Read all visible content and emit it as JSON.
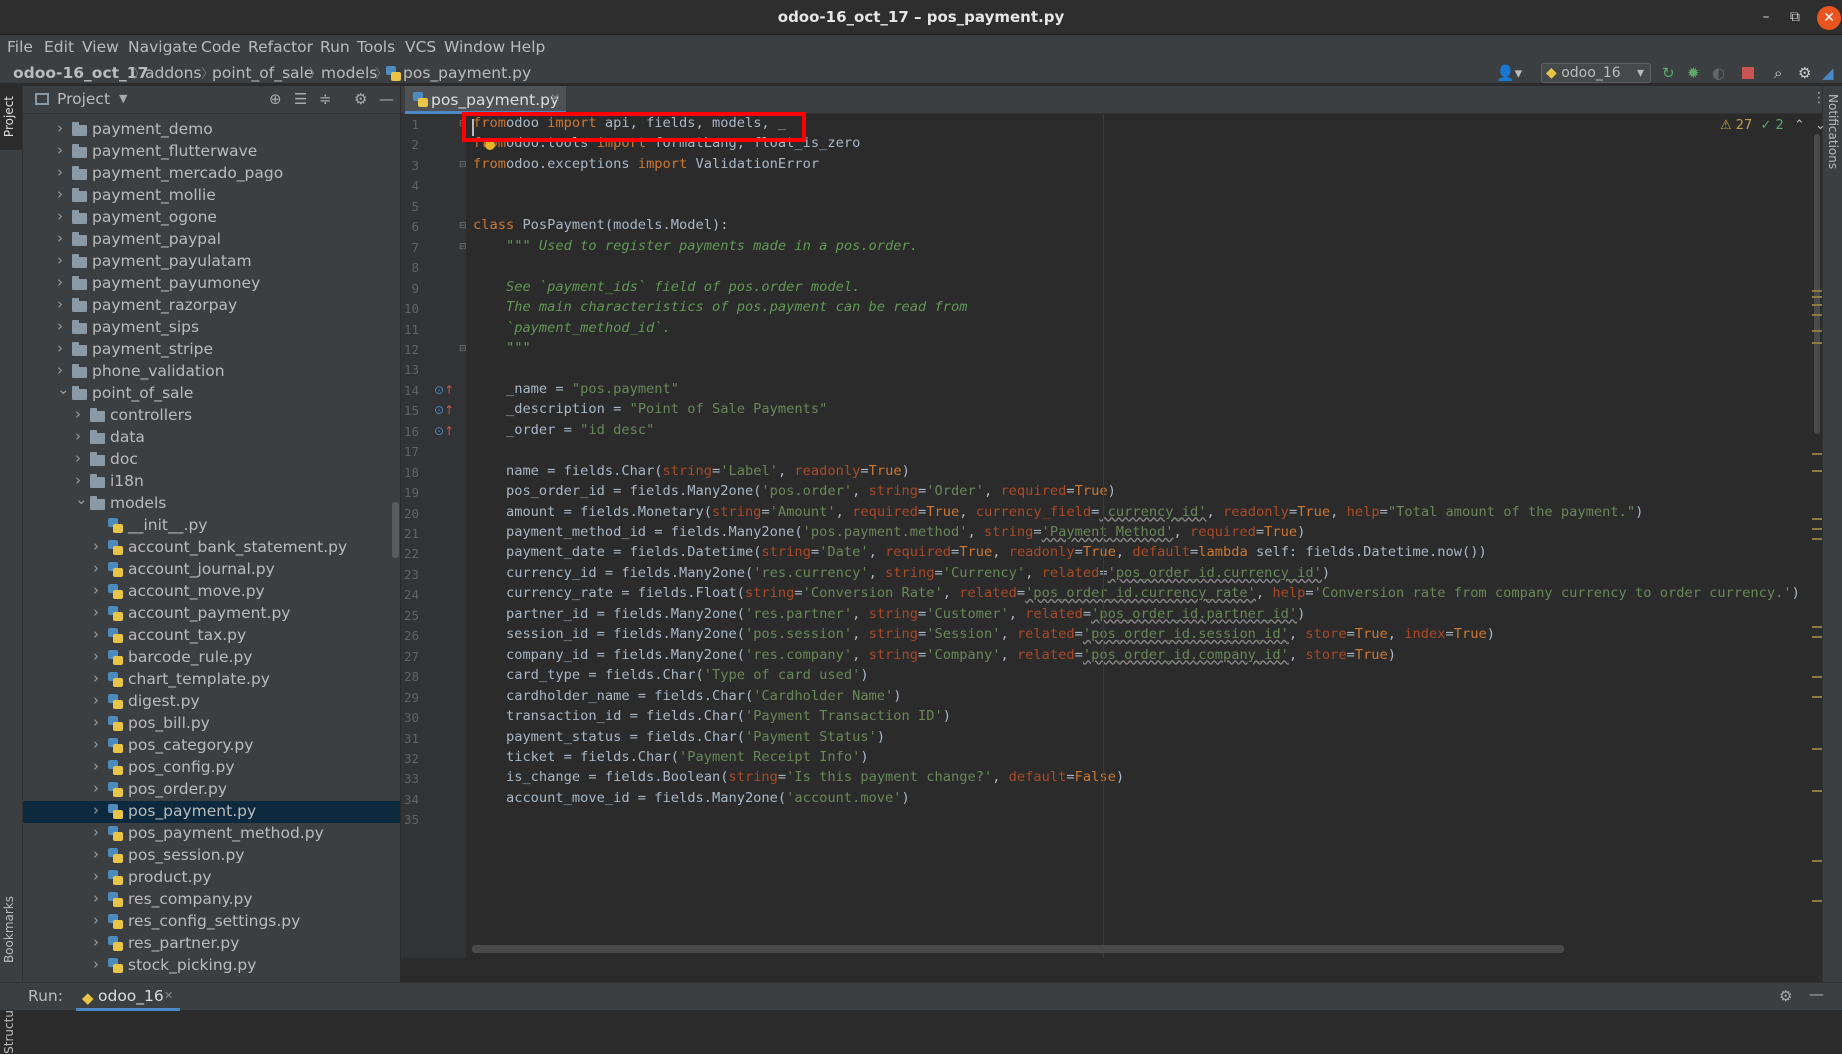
{
  "window": {
    "title": "odoo-16_oct_17 – pos_payment.py",
    "minimize": "–",
    "maximize": "⧉",
    "close": "✕"
  },
  "menu": [
    "File",
    "Edit",
    "View",
    "Navigate",
    "Code",
    "Refactor",
    "Run",
    "Tools",
    "VCS",
    "Window",
    "Help"
  ],
  "breadcrumbs": [
    "odoo-16_oct_17",
    "addons",
    "point_of_sale",
    "models",
    "pos_payment.py"
  ],
  "run_config": {
    "name": "odoo_16",
    "chevron": "▾"
  },
  "toolbar_icons": [
    "user-icon",
    "run-icon",
    "debug-icon",
    "coverage-icon",
    "stop-icon",
    "search-icon",
    "settings-icon",
    "plugin-icon"
  ],
  "left_strip": {
    "project": "Project",
    "bookmarks": "Bookmarks",
    "structure": "Structure"
  },
  "right_strip": {
    "notifications": "Notifications"
  },
  "project_panel": {
    "title": "Project",
    "tree": [
      {
        "label": "payment_demo",
        "type": "folder",
        "indent": 0,
        "expanded": false
      },
      {
        "label": "payment_flutterwave",
        "type": "folder",
        "indent": 0,
        "expanded": false
      },
      {
        "label": "payment_mercado_pago",
        "type": "folder",
        "indent": 0,
        "expanded": false
      },
      {
        "label": "payment_mollie",
        "type": "folder",
        "indent": 0,
        "expanded": false
      },
      {
        "label": "payment_ogone",
        "type": "folder",
        "indent": 0,
        "expanded": false
      },
      {
        "label": "payment_paypal",
        "type": "folder",
        "indent": 0,
        "expanded": false
      },
      {
        "label": "payment_payulatam",
        "type": "folder",
        "indent": 0,
        "expanded": false
      },
      {
        "label": "payment_payumoney",
        "type": "folder",
        "indent": 0,
        "expanded": false
      },
      {
        "label": "payment_razorpay",
        "type": "folder",
        "indent": 0,
        "expanded": false
      },
      {
        "label": "payment_sips",
        "type": "folder",
        "indent": 0,
        "expanded": false
      },
      {
        "label": "payment_stripe",
        "type": "folder",
        "indent": 0,
        "expanded": false
      },
      {
        "label": "phone_validation",
        "type": "folder",
        "indent": 0,
        "expanded": false
      },
      {
        "label": "point_of_sale",
        "type": "folder",
        "indent": 0,
        "expanded": true
      },
      {
        "label": "controllers",
        "type": "folder",
        "indent": 1,
        "expanded": false
      },
      {
        "label": "data",
        "type": "folder",
        "indent": 1,
        "expanded": false
      },
      {
        "label": "doc",
        "type": "folder",
        "indent": 1,
        "expanded": false
      },
      {
        "label": "i18n",
        "type": "folder",
        "indent": 1,
        "expanded": false
      },
      {
        "label": "models",
        "type": "folder",
        "indent": 1,
        "expanded": true
      },
      {
        "label": "__init__.py",
        "type": "py",
        "indent": 2,
        "leaf": true
      },
      {
        "label": "account_bank_statement.py",
        "type": "py",
        "indent": 2
      },
      {
        "label": "account_journal.py",
        "type": "py",
        "indent": 2
      },
      {
        "label": "account_move.py",
        "type": "py",
        "indent": 2
      },
      {
        "label": "account_payment.py",
        "type": "py",
        "indent": 2
      },
      {
        "label": "account_tax.py",
        "type": "py",
        "indent": 2
      },
      {
        "label": "barcode_rule.py",
        "type": "py",
        "indent": 2
      },
      {
        "label": "chart_template.py",
        "type": "py",
        "indent": 2
      },
      {
        "label": "digest.py",
        "type": "py",
        "indent": 2
      },
      {
        "label": "pos_bill.py",
        "type": "py",
        "indent": 2
      },
      {
        "label": "pos_category.py",
        "type": "py",
        "indent": 2
      },
      {
        "label": "pos_config.py",
        "type": "py",
        "indent": 2
      },
      {
        "label": "pos_order.py",
        "type": "py",
        "indent": 2
      },
      {
        "label": "pos_payment.py",
        "type": "py",
        "indent": 2,
        "selected": true
      },
      {
        "label": "pos_payment_method.py",
        "type": "py",
        "indent": 2
      },
      {
        "label": "pos_session.py",
        "type": "py",
        "indent": 2
      },
      {
        "label": "product.py",
        "type": "py",
        "indent": 2
      },
      {
        "label": "res_company.py",
        "type": "py",
        "indent": 2
      },
      {
        "label": "res_config_settings.py",
        "type": "py",
        "indent": 2
      },
      {
        "label": "res_partner.py",
        "type": "py",
        "indent": 2
      },
      {
        "label": "stock_picking.py",
        "type": "py",
        "indent": 2
      }
    ]
  },
  "editor": {
    "tab": {
      "label": "pos_payment.py",
      "close": "✕"
    },
    "inspections": {
      "warnings": "⚠ 27",
      "typos": "✓ 2",
      "up": "⌃",
      "down": "⌄"
    },
    "gutter_marks": [
      14,
      15,
      16
    ],
    "fold_lines": [
      1,
      3,
      6,
      7,
      12
    ],
    "lines": [
      [
        [
          "kw",
          "from"
        ],
        [
          "",
          "odoo "
        ],
        [
          "kw",
          "import"
        ],
        [
          "",
          " api, fields, models, _"
        ]
      ],
      [
        [
          "kw",
          "from"
        ],
        [
          "",
          "odoo.tools "
        ],
        [
          "kw",
          "import"
        ],
        [
          "",
          " formatLang, float_is_zero"
        ]
      ],
      [
        [
          "kw",
          "from"
        ],
        [
          "",
          "odoo.exceptions "
        ],
        [
          "kw",
          "import"
        ],
        [
          "",
          " ValidationError"
        ]
      ],
      [],
      [],
      [
        [
          "kw",
          "class"
        ],
        [
          "",
          " PosPayment(models.Model):"
        ]
      ],
      [
        [
          "",
          "    "
        ],
        [
          "dc",
          "\"\"\" Used to register payments made in a pos.order."
        ]
      ],
      [],
      [
        [
          "dc",
          "    See `payment_ids` field of pos.order model."
        ]
      ],
      [
        [
          "dc",
          "    The main characteristics of pos.payment can be read from"
        ]
      ],
      [
        [
          "dc",
          "    `payment_method_id`."
        ]
      ],
      [
        [
          "dc",
          "    \"\"\""
        ]
      ],
      [],
      [
        [
          "",
          "    _name = "
        ],
        [
          "st",
          "\"pos.payment\""
        ]
      ],
      [
        [
          "",
          "    _description = "
        ],
        [
          "st",
          "\"Point of Sale Payments\""
        ]
      ],
      [
        [
          "",
          "    _order = "
        ],
        [
          "st",
          "\"id desc\""
        ]
      ],
      [],
      [
        [
          "",
          "    name = fields.Char("
        ],
        [
          "nm",
          "string"
        ],
        [
          "",
          "="
        ],
        [
          "st",
          "'Label'"
        ],
        [
          "",
          ", "
        ],
        [
          "nm",
          "readonly"
        ],
        [
          "",
          "="
        ],
        [
          "kw",
          "True"
        ],
        [
          "",
          ")"
        ]
      ],
      [
        [
          "",
          "    pos_order_id = fields.Many2one("
        ],
        [
          "st",
          "'pos.order'"
        ],
        [
          "",
          ", "
        ],
        [
          "nm",
          "string"
        ],
        [
          "",
          "="
        ],
        [
          "st",
          "'Order'"
        ],
        [
          "",
          ", "
        ],
        [
          "nm",
          "required"
        ],
        [
          "",
          "="
        ],
        [
          "kw",
          "True"
        ],
        [
          "",
          ")"
        ]
      ],
      [
        [
          "",
          "    amount = fields.Monetary("
        ],
        [
          "nm",
          "string"
        ],
        [
          "",
          "="
        ],
        [
          "st",
          "'Amount'"
        ],
        [
          "",
          ", "
        ],
        [
          "nm",
          "required"
        ],
        [
          "",
          "="
        ],
        [
          "kw",
          "True"
        ],
        [
          "",
          ", "
        ],
        [
          "nm",
          "currency_field"
        ],
        [
          "",
          "="
        ],
        [
          "st",
          "'currency_id'"
        ],
        [
          "",
          ", "
        ],
        [
          "nm",
          "readonly"
        ],
        [
          "",
          "="
        ],
        [
          "kw",
          "True"
        ],
        [
          "",
          ", "
        ],
        [
          "nm",
          "help"
        ],
        [
          "",
          "="
        ],
        [
          "st",
          "\"Total amount of the payment.\""
        ],
        [
          "",
          ")"
        ]
      ],
      [
        [
          "",
          "    payment_method_id = fields.Many2one("
        ],
        [
          "st",
          "'pos.payment.method'"
        ],
        [
          "",
          ", "
        ],
        [
          "nm",
          "string"
        ],
        [
          "",
          "="
        ],
        [
          "st",
          "'Payment Method'"
        ],
        [
          "",
          ", "
        ],
        [
          "nm",
          "required"
        ],
        [
          "",
          "="
        ],
        [
          "kw",
          "True"
        ],
        [
          "",
          ")"
        ]
      ],
      [
        [
          "",
          "    payment_date = fields.Datetime("
        ],
        [
          "nm",
          "string"
        ],
        [
          "",
          "="
        ],
        [
          "st",
          "'Date'"
        ],
        [
          "",
          ", "
        ],
        [
          "nm",
          "required"
        ],
        [
          "",
          "="
        ],
        [
          "kw",
          "True"
        ],
        [
          "",
          ", "
        ],
        [
          "nm",
          "readonly"
        ],
        [
          "",
          "="
        ],
        [
          "kw",
          "True"
        ],
        [
          "",
          ", "
        ],
        [
          "nm",
          "default"
        ],
        [
          "",
          "="
        ],
        [
          "kw",
          "lambda"
        ],
        [
          "",
          " self: fields.Datetime.now())"
        ]
      ],
      [
        [
          "",
          "    currency_id = fields.Many2one("
        ],
        [
          "st",
          "'res.currency'"
        ],
        [
          "",
          ", "
        ],
        [
          "nm",
          "string"
        ],
        [
          "",
          "="
        ],
        [
          "st",
          "'Currency'"
        ],
        [
          "",
          ", "
        ],
        [
          "nm",
          "related"
        ],
        [
          "",
          "="
        ],
        [
          "st",
          "'pos_order_id.currency_id'"
        ],
        [
          "",
          ")"
        ]
      ],
      [
        [
          "",
          "    currency_rate = fields.Float("
        ],
        [
          "nm",
          "string"
        ],
        [
          "",
          "="
        ],
        [
          "st",
          "'Conversion Rate'"
        ],
        [
          "",
          ", "
        ],
        [
          "nm",
          "related"
        ],
        [
          "",
          "="
        ],
        [
          "st",
          "'pos_order_id.currency_rate'"
        ],
        [
          "",
          ", "
        ],
        [
          "nm",
          "help"
        ],
        [
          "",
          "="
        ],
        [
          "st",
          "'Conversion rate from company currency to order currency.'"
        ],
        [
          "",
          ")"
        ]
      ],
      [
        [
          "",
          "    partner_id = fields.Many2one("
        ],
        [
          "st",
          "'res.partner'"
        ],
        [
          "",
          ", "
        ],
        [
          "nm",
          "string"
        ],
        [
          "",
          "="
        ],
        [
          "st",
          "'Customer'"
        ],
        [
          "",
          ", "
        ],
        [
          "nm",
          "related"
        ],
        [
          "",
          "="
        ],
        [
          "st",
          "'pos_order_id.partner_id'"
        ],
        [
          "",
          ")"
        ]
      ],
      [
        [
          "",
          "    session_id = fields.Many2one("
        ],
        [
          "st",
          "'pos.session'"
        ],
        [
          "",
          ", "
        ],
        [
          "nm",
          "string"
        ],
        [
          "",
          "="
        ],
        [
          "st",
          "'Session'"
        ],
        [
          "",
          ", "
        ],
        [
          "nm",
          "related"
        ],
        [
          "",
          "="
        ],
        [
          "st",
          "'pos_order_id.session_id'"
        ],
        [
          "",
          ", "
        ],
        [
          "nm",
          "store"
        ],
        [
          "",
          "="
        ],
        [
          "kw",
          "True"
        ],
        [
          "",
          ", "
        ],
        [
          "nm",
          "index"
        ],
        [
          "",
          "="
        ],
        [
          "kw",
          "True"
        ],
        [
          "",
          ")"
        ]
      ],
      [
        [
          "",
          "    company_id = fields.Many2one("
        ],
        [
          "st",
          "'res.company'"
        ],
        [
          "",
          ", "
        ],
        [
          "nm",
          "string"
        ],
        [
          "",
          "="
        ],
        [
          "st",
          "'Company'"
        ],
        [
          "",
          ", "
        ],
        [
          "nm",
          "related"
        ],
        [
          "",
          "="
        ],
        [
          "st",
          "'pos_order_id.company_id'"
        ],
        [
          "",
          ", "
        ],
        [
          "nm",
          "store"
        ],
        [
          "",
          "="
        ],
        [
          "kw",
          "True"
        ],
        [
          "",
          ")"
        ]
      ],
      [
        [
          "",
          "    card_type = fields.Char("
        ],
        [
          "st",
          "'Type of card used'"
        ],
        [
          "",
          ")"
        ]
      ],
      [
        [
          "",
          "    cardholder_name = fields.Char("
        ],
        [
          "st",
          "'Cardholder Name'"
        ],
        [
          "",
          ")"
        ]
      ],
      [
        [
          "",
          "    transaction_id = fields.Char("
        ],
        [
          "st",
          "'Payment Transaction ID'"
        ],
        [
          "",
          ")"
        ]
      ],
      [
        [
          "",
          "    payment_status = fields.Char("
        ],
        [
          "st",
          "'Payment Status'"
        ],
        [
          "",
          ")"
        ]
      ],
      [
        [
          "",
          "    ticket = fields.Char("
        ],
        [
          "st",
          "'Payment Receipt Info'"
        ],
        [
          "",
          ")"
        ]
      ],
      [
        [
          "",
          "    is_change = fields.Boolean("
        ],
        [
          "nm",
          "string"
        ],
        [
          "",
          "="
        ],
        [
          "st",
          "'Is this payment change?'"
        ],
        [
          "",
          ", "
        ],
        [
          "nm",
          "default"
        ],
        [
          "",
          "="
        ],
        [
          "kw",
          "False"
        ],
        [
          "",
          ")"
        ]
      ],
      [
        [
          "",
          "    account_move_id = fields.Many2one("
        ],
        [
          "st",
          "'account.move'"
        ],
        [
          "",
          ")"
        ]
      ],
      []
    ]
  },
  "run_bar": {
    "label": "Run:",
    "tab": "odoo_16",
    "close": "✕"
  }
}
